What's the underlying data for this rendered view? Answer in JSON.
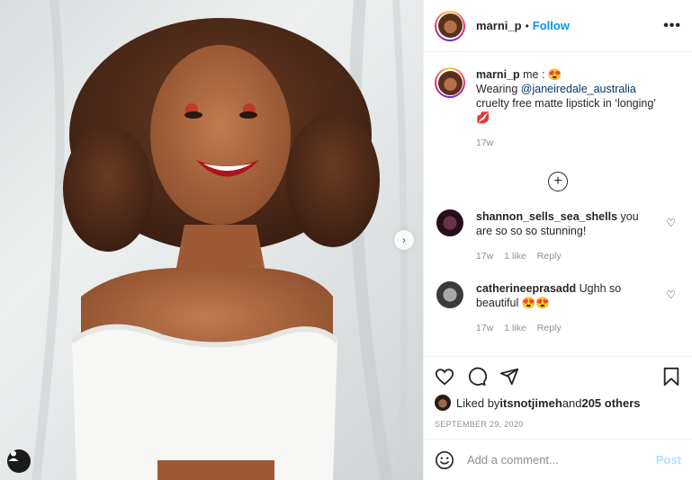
{
  "header": {
    "username": "marni_p",
    "separator": "•",
    "follow_label": "Follow",
    "more_icon": "more-horizontal-icon",
    "more_glyph": "•••"
  },
  "caption": {
    "username": "marni_p",
    "text_before": " me : ",
    "emoji_1": "😍",
    "line2_prefix": "Wearing ",
    "mention": "@janeiredale_australia",
    "line3": "cruelty free matte lipstick in ‘longing’",
    "emoji_2": "💋",
    "age": "17w"
  },
  "load_more_icon": "plus-circle-icon",
  "load_more_glyph": "+",
  "comments": [
    {
      "username": "shannon_sells_sea_shells",
      "text": " you are so so so stunning!",
      "age": "17w",
      "likes": "1 like",
      "reply": "Reply"
    },
    {
      "username": "catherineeprasadd",
      "text": " Ughh so beautiful ",
      "emoji": "😍😍",
      "age": "17w",
      "likes": "1 like",
      "reply": "Reply"
    }
  ],
  "heart_small_glyph": "♡",
  "actions": {
    "like_icon": "heart-icon",
    "comment_icon": "comment-icon",
    "share_icon": "send-icon",
    "save_icon": "bookmark-icon"
  },
  "likes": {
    "prefix": "Liked by ",
    "user": "itsnotjimeh",
    "middle": " and ",
    "others": "205 others"
  },
  "date": "SEPTEMBER 29, 2020",
  "add_comment": {
    "placeholder": "Add a comment...",
    "post_label": "Post"
  },
  "photo": {
    "next_glyph": "›"
  },
  "colors": {
    "accent": "#0095f6",
    "post_disabled": "#b2dffc",
    "muted": "#8e8e8e",
    "mention": "#00376b"
  }
}
